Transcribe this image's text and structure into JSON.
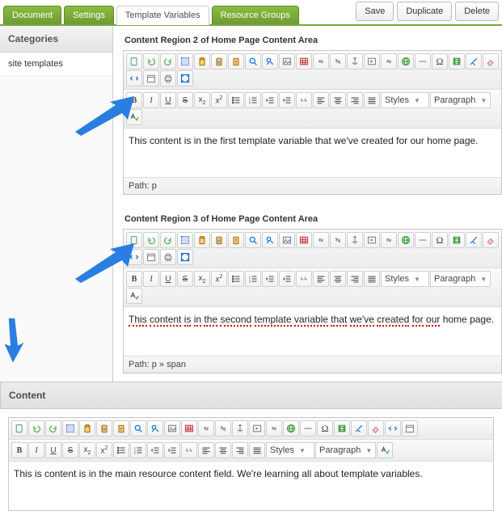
{
  "tabs": {
    "document": "Document",
    "settings": "Settings",
    "template_vars": "Template Variables",
    "resource_groups": "Resource Groups"
  },
  "actions": {
    "save": "Save",
    "duplicate": "Duplicate",
    "delete": "Delete"
  },
  "sidebar": {
    "heading": "Categories",
    "item0": "site templates"
  },
  "region1": {
    "title": "Content Region 2 of Home Page Content Area",
    "body": "This content is in the first template variable that we've created for our home page.",
    "path": "Path: p"
  },
  "region2": {
    "title": "Content Region 3 of Home Page Content Area",
    "body": "This content is in the second template variable that we've created for our home page.",
    "path": "Path: p » span"
  },
  "contentSection": {
    "heading": "Content",
    "body": "This is content is in the main resource content field. We're learning all about template variables."
  },
  "toolbar": {
    "styles": "Styles",
    "paragraph": "Paragraph"
  }
}
